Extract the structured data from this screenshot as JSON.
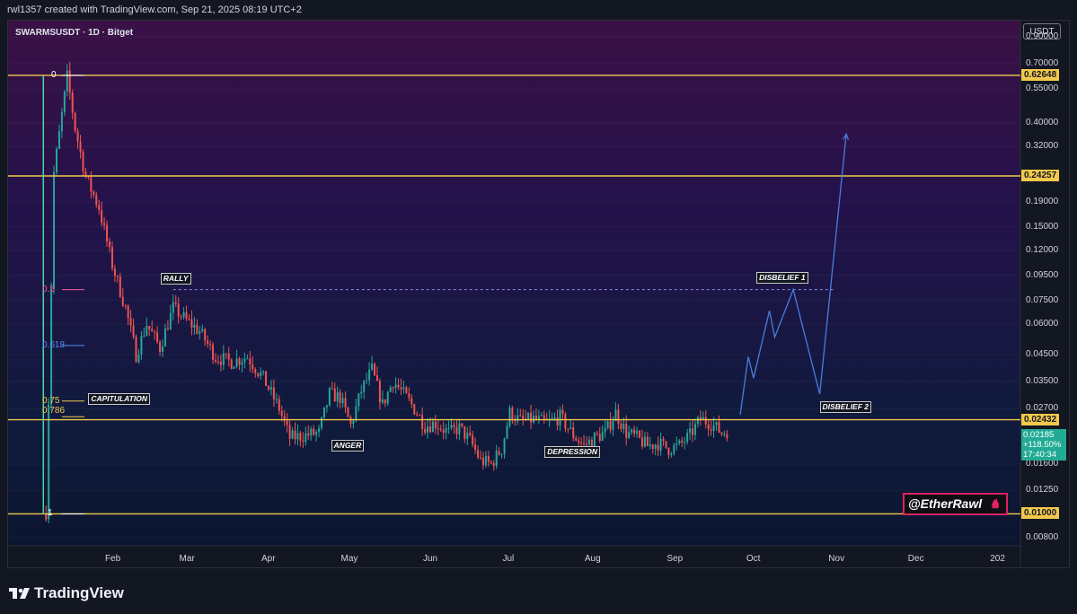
{
  "header": {
    "text": "rwl1357 created with TradingView.com, Sep 21, 2025 08:19 UTC+2"
  },
  "legend": {
    "symbol": "SWARMSUSDT · 1D · Bitget"
  },
  "footer": {
    "brand": "TradingView"
  },
  "watermark": {
    "text": "@EtherRawl"
  },
  "colors": {
    "background": "#131722",
    "up": "#26a69a",
    "down": "#ef5350",
    "level_line": "#f2c94c",
    "projection": "#4a7ddb",
    "price_badge": "#22ab94"
  },
  "chart_data": {
    "type": "candlestick",
    "symbol": "SWARMSUSDT",
    "interval": "1D",
    "exchange": "Bitget",
    "y_scale": "log",
    "ylim": [
      0.0074,
      1.05
    ],
    "y_axis_label": "USDT",
    "y_ticks": [
      "0.90000",
      "0.70000",
      "0.55000",
      "0.40000",
      "0.32000",
      "0.19000",
      "0.15000",
      "0.12000",
      "0.09500",
      "0.07500",
      "0.06000",
      "0.04500",
      "0.03500",
      "0.02700",
      "0.01600",
      "0.01250",
      "0.00800"
    ],
    "x_ticks": [
      "Feb",
      "Mar",
      "Apr",
      "May",
      "Jun",
      "Jul",
      "Aug",
      "Sep",
      "Oct",
      "Nov",
      "Dec",
      "202"
    ],
    "price_levels": [
      {
        "label": "0.62648",
        "value": 0.62648
      },
      {
        "label": "0.24257",
        "value": 0.24257
      },
      {
        "label": "0.02432",
        "value": 0.02432
      },
      {
        "label": "0.01000",
        "value": 0.01
      }
    ],
    "current_price": {
      "price": "0.02185",
      "change": "+118.50%",
      "countdown": "17:40:34",
      "value": 0.02185
    },
    "fib_levels": [
      {
        "label": "0",
        "value": 0.62648,
        "color": "#ffffff"
      },
      {
        "label": "0.5",
        "value": 0.083,
        "color": "#ef5d8a"
      },
      {
        "label": "0.618",
        "value": 0.049,
        "color": "#5b8def"
      },
      {
        "label": "0.75",
        "value": 0.029,
        "color": "#f2c94c"
      },
      {
        "label": "0.786",
        "value": 0.025,
        "color": "#f2c94c"
      },
      {
        "label": "1",
        "value": 0.01,
        "color": "#ffffff"
      }
    ],
    "resistance_dashed": {
      "value": 0.083,
      "from_date": "2025-02-24",
      "to_date": "2025-10-31"
    },
    "annotations": [
      {
        "label": "RALLY",
        "date": "2025-02-24",
        "value": 0.083
      },
      {
        "label": "CAPITULATION",
        "date": "2025-02-05",
        "value": 0.028
      },
      {
        "label": "ANGER",
        "date": "2025-04-30",
        "value": 0.018
      },
      {
        "label": "DEPRESSION",
        "date": "2025-07-25",
        "value": 0.017
      },
      {
        "label": "DISBELIEF 1",
        "date": "2025-10-15",
        "value": 0.088
      },
      {
        "label": "DISBELIEF 2",
        "date": "2025-10-28",
        "value": 0.028
      }
    ],
    "projection": [
      {
        "date": "2025-09-26",
        "value": 0.0255
      },
      {
        "date": "2025-09-29",
        "value": 0.044
      },
      {
        "date": "2025-10-01",
        "value": 0.036
      },
      {
        "date": "2025-10-07",
        "value": 0.068
      },
      {
        "date": "2025-10-09",
        "value": 0.053
      },
      {
        "date": "2025-10-16",
        "value": 0.083
      },
      {
        "date": "2025-10-26",
        "value": 0.031
      },
      {
        "date": "2025-11-05",
        "value": 0.36
      }
    ],
    "anchors": [
      {
        "date": "2025-01-07",
        "value": 0.01
      },
      {
        "date": "2025-01-10",
        "value": 0.25
      },
      {
        "date": "2025-01-15",
        "value": 0.62
      },
      {
        "date": "2025-01-18",
        "value": 0.38
      },
      {
        "date": "2025-01-22",
        "value": 0.24
      },
      {
        "date": "2025-01-27",
        "value": 0.18
      },
      {
        "date": "2025-02-01",
        "value": 0.105
      },
      {
        "date": "2025-02-06",
        "value": 0.07
      },
      {
        "date": "2025-02-10",
        "value": 0.045
      },
      {
        "date": "2025-02-14",
        "value": 0.06
      },
      {
        "date": "2025-02-19",
        "value": 0.048
      },
      {
        "date": "2025-02-24",
        "value": 0.07
      },
      {
        "date": "2025-03-01",
        "value": 0.062
      },
      {
        "date": "2025-03-06",
        "value": 0.056
      },
      {
        "date": "2025-03-12",
        "value": 0.044
      },
      {
        "date": "2025-03-18",
        "value": 0.042
      },
      {
        "date": "2025-03-24",
        "value": 0.044
      },
      {
        "date": "2025-03-30",
        "value": 0.036
      },
      {
        "date": "2025-04-05",
        "value": 0.027
      },
      {
        "date": "2025-04-09",
        "value": 0.0205
      },
      {
        "date": "2025-04-15",
        "value": 0.021
      },
      {
        "date": "2025-04-20",
        "value": 0.0215
      },
      {
        "date": "2025-04-24",
        "value": 0.031
      },
      {
        "date": "2025-04-28",
        "value": 0.03
      },
      {
        "date": "2025-05-02",
        "value": 0.023
      },
      {
        "date": "2025-05-06",
        "value": 0.032
      },
      {
        "date": "2025-05-10",
        "value": 0.039
      },
      {
        "date": "2025-05-14",
        "value": 0.028
      },
      {
        "date": "2025-05-18",
        "value": 0.035
      },
      {
        "date": "2025-05-22",
        "value": 0.031
      },
      {
        "date": "2025-05-26",
        "value": 0.027
      },
      {
        "date": "2025-05-30",
        "value": 0.023
      },
      {
        "date": "2025-06-03",
        "value": 0.0235
      },
      {
        "date": "2025-06-08",
        "value": 0.0215
      },
      {
        "date": "2025-06-12",
        "value": 0.0225
      },
      {
        "date": "2025-06-16",
        "value": 0.02
      },
      {
        "date": "2025-06-20",
        "value": 0.0165
      },
      {
        "date": "2025-06-24",
        "value": 0.016
      },
      {
        "date": "2025-06-28",
        "value": 0.0185
      },
      {
        "date": "2025-07-01",
        "value": 0.026
      },
      {
        "date": "2025-07-05",
        "value": 0.024
      },
      {
        "date": "2025-07-10",
        "value": 0.0245
      },
      {
        "date": "2025-07-15",
        "value": 0.0235
      },
      {
        "date": "2025-07-20",
        "value": 0.025
      },
      {
        "date": "2025-07-25",
        "value": 0.021
      },
      {
        "date": "2025-07-29",
        "value": 0.019
      },
      {
        "date": "2025-08-02",
        "value": 0.0205
      },
      {
        "date": "2025-08-06",
        "value": 0.0215
      },
      {
        "date": "2025-08-10",
        "value": 0.026
      },
      {
        "date": "2025-08-14",
        "value": 0.0215
      },
      {
        "date": "2025-08-18",
        "value": 0.0205
      },
      {
        "date": "2025-08-22",
        "value": 0.019
      },
      {
        "date": "2025-08-26",
        "value": 0.0195
      },
      {
        "date": "2025-08-30",
        "value": 0.0185
      },
      {
        "date": "2025-09-03",
        "value": 0.019
      },
      {
        "date": "2025-09-07",
        "value": 0.021
      },
      {
        "date": "2025-09-11",
        "value": 0.0245
      },
      {
        "date": "2025-09-15",
        "value": 0.0235
      },
      {
        "date": "2025-09-19",
        "value": 0.0215
      },
      {
        "date": "2025-09-21",
        "value": 0.0219
      }
    ]
  }
}
